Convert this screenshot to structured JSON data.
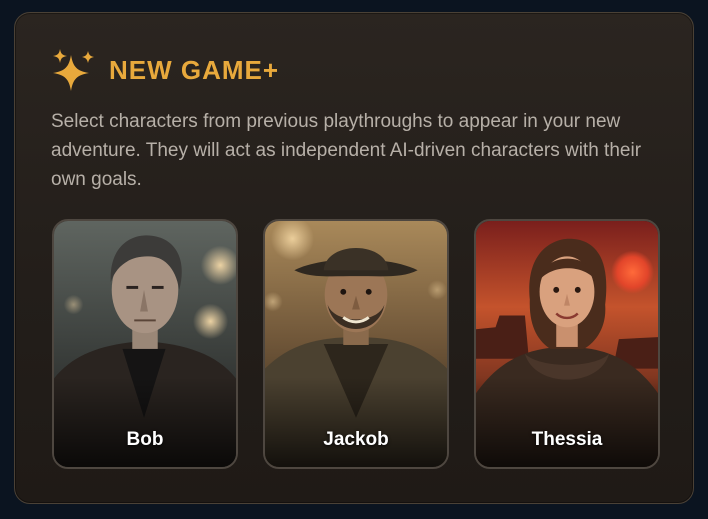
{
  "panel": {
    "title": "NEW GAME+",
    "icon": "sparkles-icon",
    "description": "Select characters from previous playthroughs to appear in your new adventure. They will act as independent AI-driven characters with their own goals."
  },
  "characters": [
    {
      "name": "Bob"
    },
    {
      "name": "Jackob"
    },
    {
      "name": "Thessia"
    }
  ],
  "colors": {
    "accent": "#e8a93c",
    "panel_bg": "#231e1a",
    "text_muted": "#b7b0a8",
    "page_bg": "#0b1420"
  }
}
